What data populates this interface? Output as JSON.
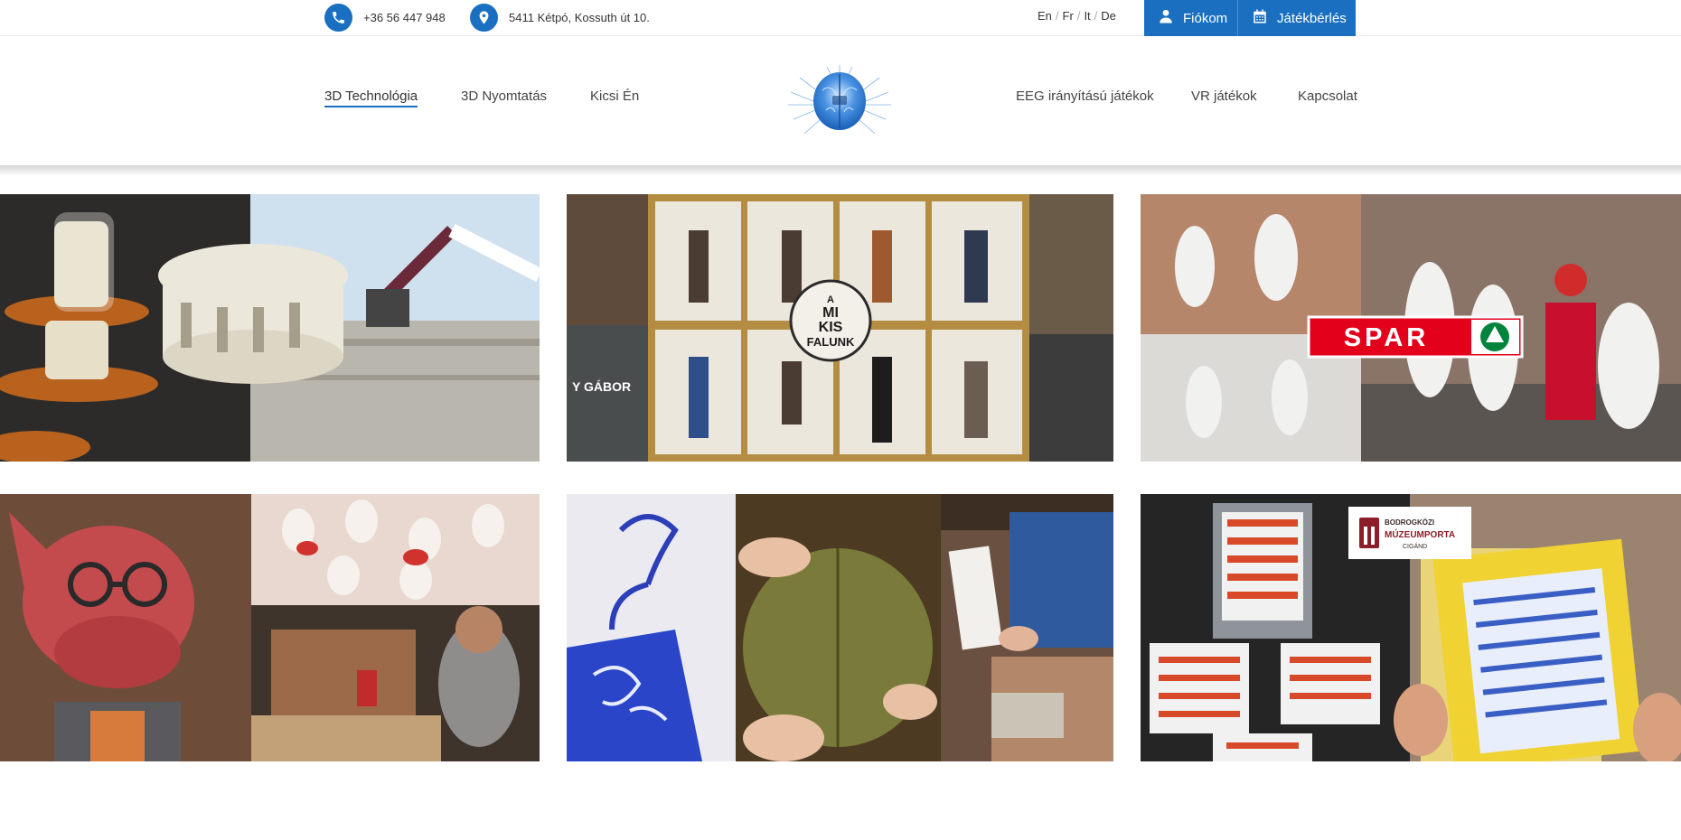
{
  "topbar": {
    "phone": "+36 56 447 948",
    "address": "5411 Kétpó, Kossuth út 10.",
    "languages": [
      "En",
      "Fr",
      "It",
      "De"
    ],
    "account_label": "Fiókom",
    "rent_label": "Játékbérlés"
  },
  "nav": {
    "left": [
      "3D Technológia",
      "3D Nyomtatás",
      "Kicsi Én"
    ],
    "right": [
      "EEG irányítású játékok",
      "VR játékok",
      "Kapcsolat"
    ],
    "active": "3D Technológia"
  },
  "tiles": {
    "t2": {
      "badge_lines": [
        "A",
        "MI",
        "KIS",
        "FALUNK"
      ],
      "side_text": "Y GÁBOR"
    },
    "t3": {
      "brand": "SPAR"
    },
    "t6": {
      "logo_line1": "BODROGKÖZI",
      "logo_line2": "MÚZEUMPORTA",
      "logo_line3": "CIGÁND"
    }
  },
  "colors": {
    "accent": "#1a6fc0",
    "spar_red": "#e3001b",
    "spar_green": "#00843d"
  }
}
